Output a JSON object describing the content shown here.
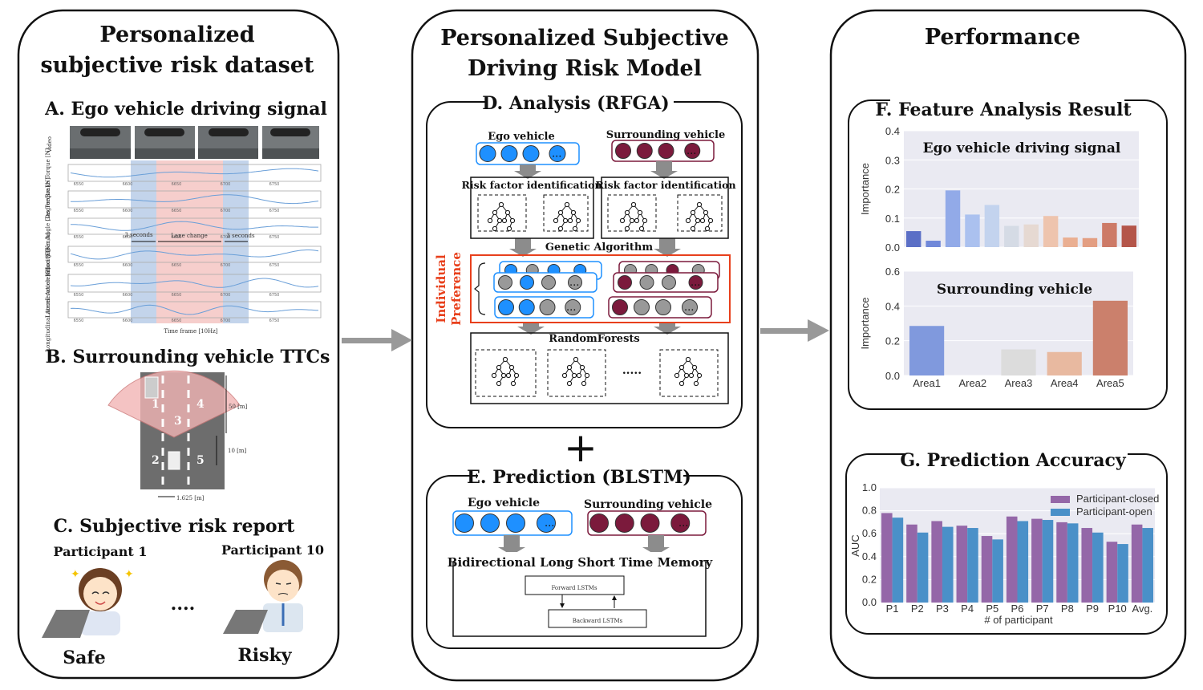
{
  "left": {
    "title_line1": "Personalized",
    "title_line2": "subjective risk dataset",
    "sectionA": "A. Ego vehicle driving signal",
    "signal_rows": [
      "Video",
      "Brake Torque [N]",
      "Gas Torque [N]",
      "Steer Angle [Degree]",
      "Velocity [Km/h]",
      "Lateral Acceleration [G]",
      "Longitudinal Acceleration [G]"
    ],
    "signal_ticks": [
      "6550",
      "6600",
      "6650",
      "6700",
      "6750"
    ],
    "annot_3s_left": "3 seconds",
    "annot_lane_change": "Lane change",
    "annot_3s_right": "3 seconds",
    "time_axis": "Time frame [10Hz]",
    "sectionB": "B. Surrounding vehicle TTCs",
    "areas": [
      "1",
      "2",
      "3",
      "4",
      "5"
    ],
    "dist_50": "50 [m]",
    "dist_10": "10 [m]",
    "lane_width": "1.625 [m]",
    "sectionC": "C. Subjective risk report",
    "participant1": "Participant 1",
    "participant10": "Participant 10",
    "ellipsis": "....",
    "safe": "Safe",
    "risky": "Risky"
  },
  "middle": {
    "title_line1": "Personalized Subjective",
    "title_line2": "Driving Risk Model",
    "sectionD": "D. Analysis (RFGA)",
    "ego_vehicle": "Ego vehicle",
    "surrounding_vehicle": "Surrounding vehicle",
    "risk_factor_id": "Risk factor identification",
    "genetic_algorithm": "Genetic Algorithm",
    "individual_pref_line1": "Individual",
    "individual_pref_line2": "Preference",
    "random_forests": "RandomForests",
    "dots": ".....",
    "plus": "+",
    "sectionE": "E. Prediction (BLSTM)",
    "blstm": "Bidirectional Long Short Time Memory",
    "forward": "Forward LSTMs",
    "backward": "Backward LSTMs",
    "colors": {
      "ego": "#1e90ff",
      "surround": "#7b1a3c",
      "preference": "#e8401c",
      "arrow": "#8c8c8c"
    }
  },
  "right": {
    "title": "Performance",
    "sectionF": "F. Feature Analysis Result",
    "sectionG": "G. Prediction Accuracy"
  },
  "chart_data": [
    {
      "type": "bar",
      "title": "Ego vehicle driving signal",
      "ylabel": "Importance",
      "ylim": [
        0,
        0.4
      ],
      "yticks": [
        "0.0",
        "0.1",
        "0.2",
        "0.3",
        "0.4"
      ],
      "values": [
        0.055,
        0.022,
        0.195,
        0.112,
        0.145,
        0.073,
        0.078,
        0.107,
        0.033,
        0.031,
        0.083,
        0.074
      ],
      "colors": [
        "#5b6fc6",
        "#7088d9",
        "#92aae8",
        "#abc1ef",
        "#c3d3ee",
        "#d5dbe5",
        "#e6d9d2",
        "#eec4ae",
        "#eaaf92",
        "#e39e82",
        "#cd7a67",
        "#b4554a"
      ],
      "grid": true
    },
    {
      "type": "bar",
      "title": "Surrounding vehicle",
      "ylabel": "Importance",
      "ylim": [
        0,
        0.6
      ],
      "yticks": [
        "0.0",
        "0.2",
        "0.4",
        "0.6"
      ],
      "categories": [
        "Area1",
        "Area2",
        "Area3",
        "Area4",
        "Area5"
      ],
      "values": [
        0.285,
        0.0,
        0.15,
        0.135,
        0.43
      ],
      "colors": [
        "#8099dd",
        "#c8c8c8",
        "#dcdcdc",
        "#e8b9a0",
        "#cb806c"
      ],
      "grid": true
    },
    {
      "type": "bar",
      "xlabel": "# of participant",
      "ylabel": "AUC",
      "ylim": [
        0,
        1.0
      ],
      "yticks": [
        "0.0",
        "0.2",
        "0.4",
        "0.6",
        "0.8",
        "1.0"
      ],
      "categories": [
        "P1",
        "P2",
        "P3",
        "P4",
        "P5",
        "P6",
        "P7",
        "P8",
        "P9",
        "P10",
        "Avg."
      ],
      "series": [
        {
          "name": "Participant-closed",
          "color": "#9467a8",
          "values": [
            0.78,
            0.68,
            0.71,
            0.67,
            0.58,
            0.75,
            0.73,
            0.7,
            0.65,
            0.53,
            0.68
          ]
        },
        {
          "name": "Participant-open",
          "color": "#4a90c8",
          "values": [
            0.74,
            0.61,
            0.66,
            0.65,
            0.55,
            0.71,
            0.72,
            0.69,
            0.61,
            0.51,
            0.65
          ]
        }
      ],
      "legend": "top-right",
      "grid": true
    }
  ]
}
